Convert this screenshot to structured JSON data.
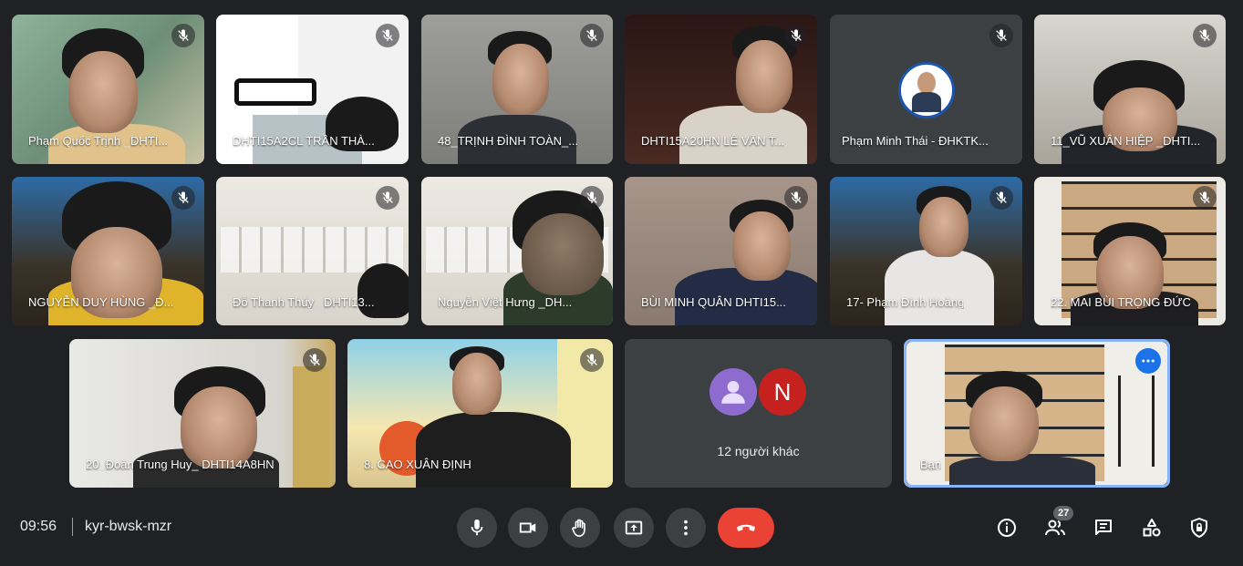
{
  "participants": [
    {
      "name": "Phạm Quốc Trịnh _DHTI...",
      "muted": true
    },
    {
      "name": "DHTI15A2CL TRẦN THÀ...",
      "muted": true
    },
    {
      "name": "48_TRỊNH ĐÌNH TOÀN_...",
      "muted": true
    },
    {
      "name": "DHTI15A20HN LÊ VĂN T...",
      "muted": true
    },
    {
      "name": "Phạm Minh Thái - ĐHKTK...",
      "muted": true
    },
    {
      "name": "11_VŨ XUÂN HIỆP _DHTI...",
      "muted": true
    },
    {
      "name": "NGUYỄN DUY HÙNG _Đ...",
      "muted": true
    },
    {
      "name": "Đỗ Thanh Thúy _DHTI13...",
      "muted": true
    },
    {
      "name": "Nguyễn Việt Hưng _DH...",
      "muted": true
    },
    {
      "name": "BÙI MINH QUÂN DHTI15...",
      "muted": true
    },
    {
      "name": "17- Phạm Đình Hoàng",
      "muted": true
    },
    {
      "name": "22. MAI BÙI TRỌNG ĐỨC",
      "muted": true
    },
    {
      "name": "20_Đoàn Trung Huy_ DHTI14A8HN",
      "muted": true
    },
    {
      "name": "8. CAO XUÂN ĐỊNH",
      "muted": true
    }
  ],
  "others_tile": {
    "label": "12 người khác",
    "avatar_letter": "N",
    "avatar_color": "#c5221f",
    "generic_avatar_color": "#8e6ccf"
  },
  "self_tile": {
    "name": "Bạn",
    "accent": "#8ab4f8"
  },
  "bottom_bar": {
    "time": "09:56",
    "meeting_code": "kyr-bwsk-mzr",
    "participant_count": "27",
    "controls": [
      "mic-icon",
      "camera-icon",
      "raise-hand-icon",
      "present-icon",
      "more-options-icon",
      "end-call-icon"
    ],
    "side_controls": [
      "info-icon",
      "people-icon",
      "chat-icon",
      "activities-icon",
      "host-controls-icon"
    ]
  },
  "colors": {
    "background": "#202124",
    "end_call": "#ea4335",
    "control_bg": "#3c4043"
  }
}
